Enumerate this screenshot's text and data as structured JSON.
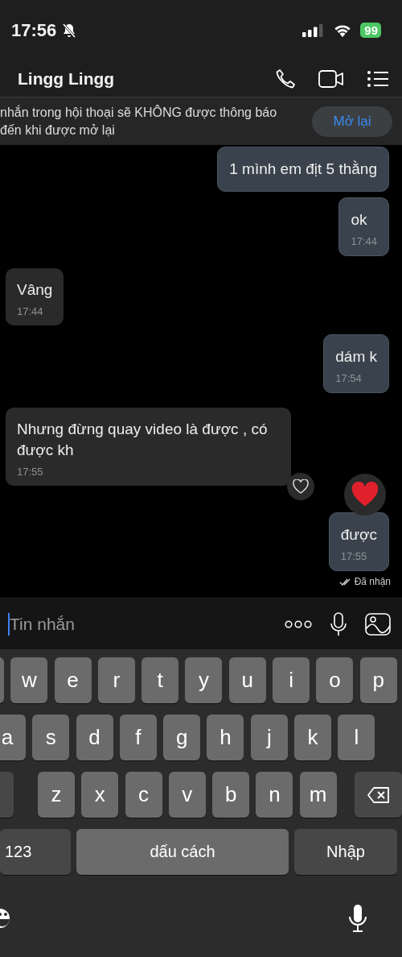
{
  "status_bar": {
    "time": "17:56",
    "silent": true,
    "battery": "99"
  },
  "header": {
    "title": "Lingg Lingg"
  },
  "banner": {
    "lines": [
      "nhắn trong hội thoại sẽ KHÔNG được thông báo",
      "đến khi được mở lại"
    ],
    "button": "Mở lại"
  },
  "messages": [
    {
      "kind": "outgoing",
      "text": "1 mình em địt 5 thằng"
    },
    {
      "kind": "outgoing",
      "text": "ok",
      "time": "17:44"
    },
    {
      "kind": "incoming",
      "text": "Vâng",
      "time": "17:44"
    },
    {
      "kind": "outgoing",
      "text": "dám k",
      "time": "17:54"
    },
    {
      "kind": "incoming",
      "text": "Nhưng đừng quay video là được , có được kh",
      "time": "17:55",
      "reaction": {
        "kind": "outline"
      }
    },
    {
      "kind": "outgoing",
      "text": "được",
      "time": "17:55",
      "reaction": {
        "kind": "heart"
      }
    }
  ],
  "delivery_status": "Đã nhận",
  "composer": {
    "placeholder": "Tin nhắn"
  },
  "keyboard": {
    "rows": [
      [
        "w",
        "e",
        "r",
        "t",
        "y",
        "u",
        "i",
        "o",
        "p"
      ],
      [
        "a",
        "s",
        "d",
        "f",
        "g",
        "h",
        "j",
        "k",
        "l"
      ],
      [
        "z",
        "x",
        "c",
        "v",
        "b",
        "n",
        "m"
      ]
    ],
    "numbers_key": "123",
    "space_key": "dấu cách",
    "return_key": "Nhập"
  }
}
